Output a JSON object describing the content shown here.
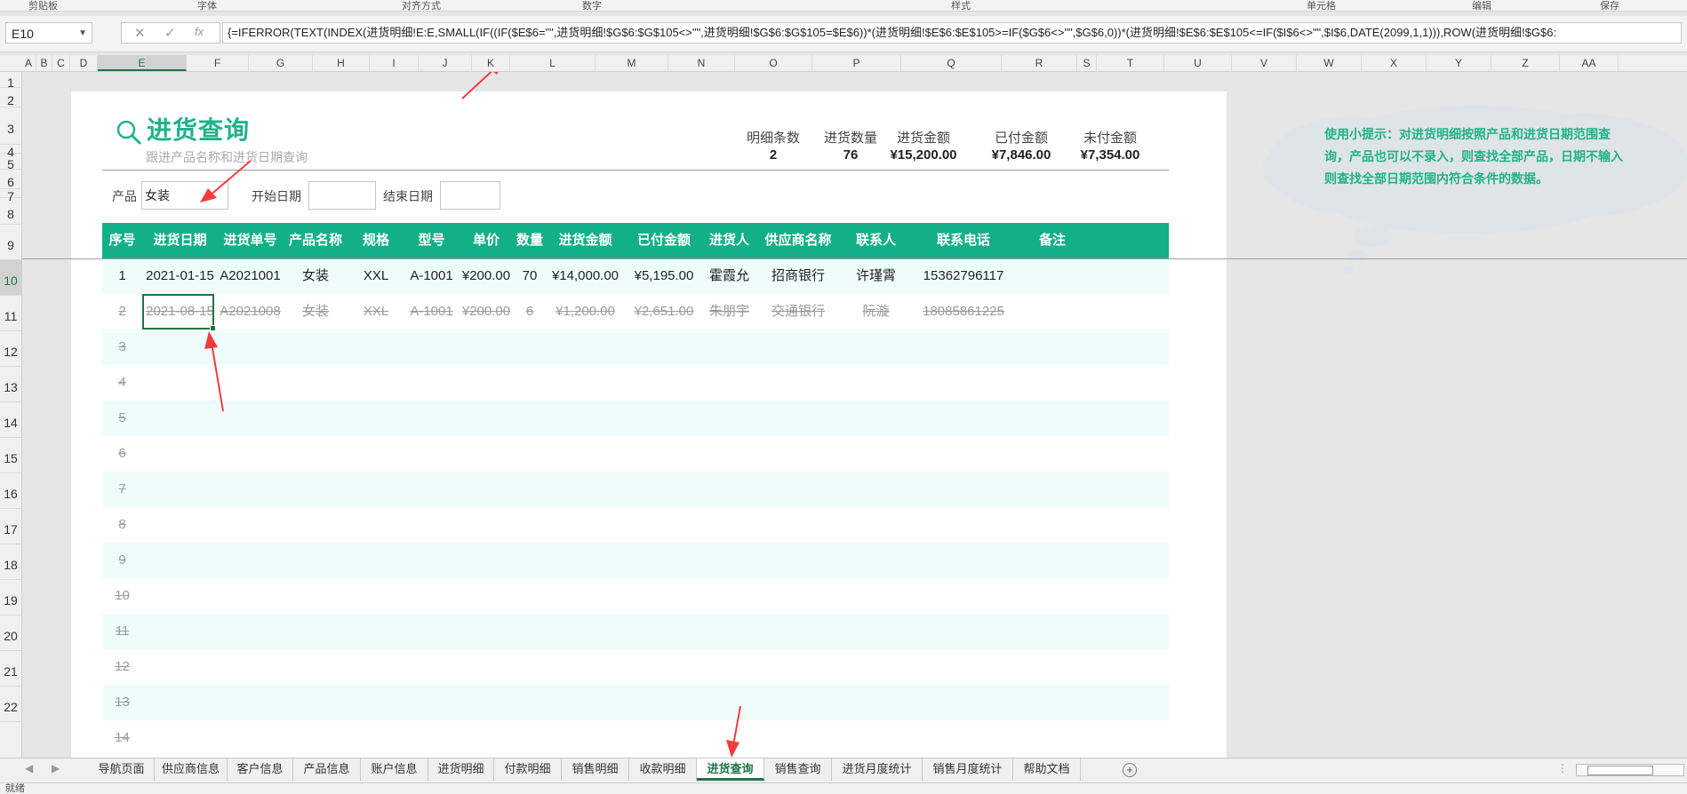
{
  "ribbon": {
    "groups": [
      "剪贴板",
      "字体",
      "对齐方式",
      "数字",
      "样式",
      "单元格",
      "编辑",
      "保存"
    ]
  },
  "formula_bar": {
    "name_box": "E10",
    "cancel_icon": "✕",
    "enter_icon": "✓",
    "fx_icon": "fx",
    "formula": "{=IFERROR(TEXT(INDEX(进货明细!E:E,SMALL(IF((IF($E$6=\"\",进货明细!$G$6:$G$105<>\"\",进货明细!$G$6:$G$105=$E$6))*(进货明细!$E$6:$E$105>=IF($G$6<>\"\",$G$6,0))*(进货明细!$E$6:$E$105<=IF($I$6<>\"\",$I$6,DATE(2099,1,1))),ROW(进货明细!$G$6:"
  },
  "columns": [
    "A",
    "B",
    "C",
    "D",
    "E",
    "F",
    "G",
    "H",
    "I",
    "J",
    "K",
    "L",
    "M",
    "N",
    "O",
    "P",
    "Q",
    "R",
    "S",
    "T",
    "U",
    "V",
    "W",
    "X",
    "Y",
    "Z",
    "AA"
  ],
  "rows": [
    "1",
    "2",
    "3",
    "4",
    "5",
    "6",
    "7",
    "8",
    "9",
    "10",
    "11",
    "12",
    "13",
    "14",
    "15",
    "16",
    "17",
    "18",
    "19",
    "20",
    "21",
    "22"
  ],
  "page": {
    "title": "进货查询",
    "subtitle": "跟进产品名称和进货日期查询",
    "summary": [
      {
        "label": "明细条数",
        "value": "2"
      },
      {
        "label": "进货数量",
        "value": "76"
      },
      {
        "label": "进货金额",
        "value": "¥15,200.00"
      },
      {
        "label": "已付金额",
        "value": "¥7,846.00"
      },
      {
        "label": "未付金额",
        "value": "¥7,354.00"
      }
    ],
    "filters": {
      "product_label": "产品",
      "product_value": "女装",
      "start_label": "开始日期",
      "start_value": "",
      "end_label": "结束日期",
      "end_value": ""
    },
    "table": {
      "headers": [
        "序号",
        "进货日期",
        "进货单号",
        "产品名称",
        "规格",
        "型号",
        "单价",
        "数量",
        "进货金额",
        "已付金额",
        "进货人",
        "供应商名称",
        "联系人",
        "联系电话",
        "备注"
      ],
      "rows": [
        [
          "1",
          "2021-01-15",
          "A2021001",
          "女装",
          "XXL",
          "A-1001",
          "¥200.00",
          "70",
          "¥14,000.00",
          "¥5,195.00",
          "霍霞允",
          "招商银行",
          "许瑾霄",
          "15362796117",
          ""
        ],
        [
          "2",
          "2021-08-15",
          "A2021008",
          "女装",
          "XXL",
          "A-1001",
          "¥200.00",
          "6",
          "¥1,200.00",
          "¥2,651.00",
          "朱朋宇",
          "交通银行",
          "阮漩",
          "18085861225",
          ""
        ]
      ],
      "empty_seq": [
        "3",
        "4",
        "5",
        "6",
        "7",
        "8",
        "9",
        "10",
        "11",
        "12",
        "13",
        "14"
      ]
    },
    "tip": "使用小提示：对进货明细按照产品和进货日期范围查询，产品也可以不录入，则查找全部产品，日期不输入则查找全部日期范围内符合条件的数据。"
  },
  "tabs": {
    "items": [
      "导航页面",
      "供应商信息",
      "客户信息",
      "产品信息",
      "账户信息",
      "进货明细",
      "付款明细",
      "销售明细",
      "收款明细",
      "进货查询",
      "销售查询",
      "进货月度统计",
      "销售月度统计",
      "帮助文档"
    ],
    "active": 9,
    "add_icon": "+"
  },
  "status": {
    "text": "就绪"
  },
  "colors": {
    "accent": "#13b087",
    "title": "#1fb38a",
    "arrow": "#f23c3c",
    "excel_green": "#217346"
  }
}
